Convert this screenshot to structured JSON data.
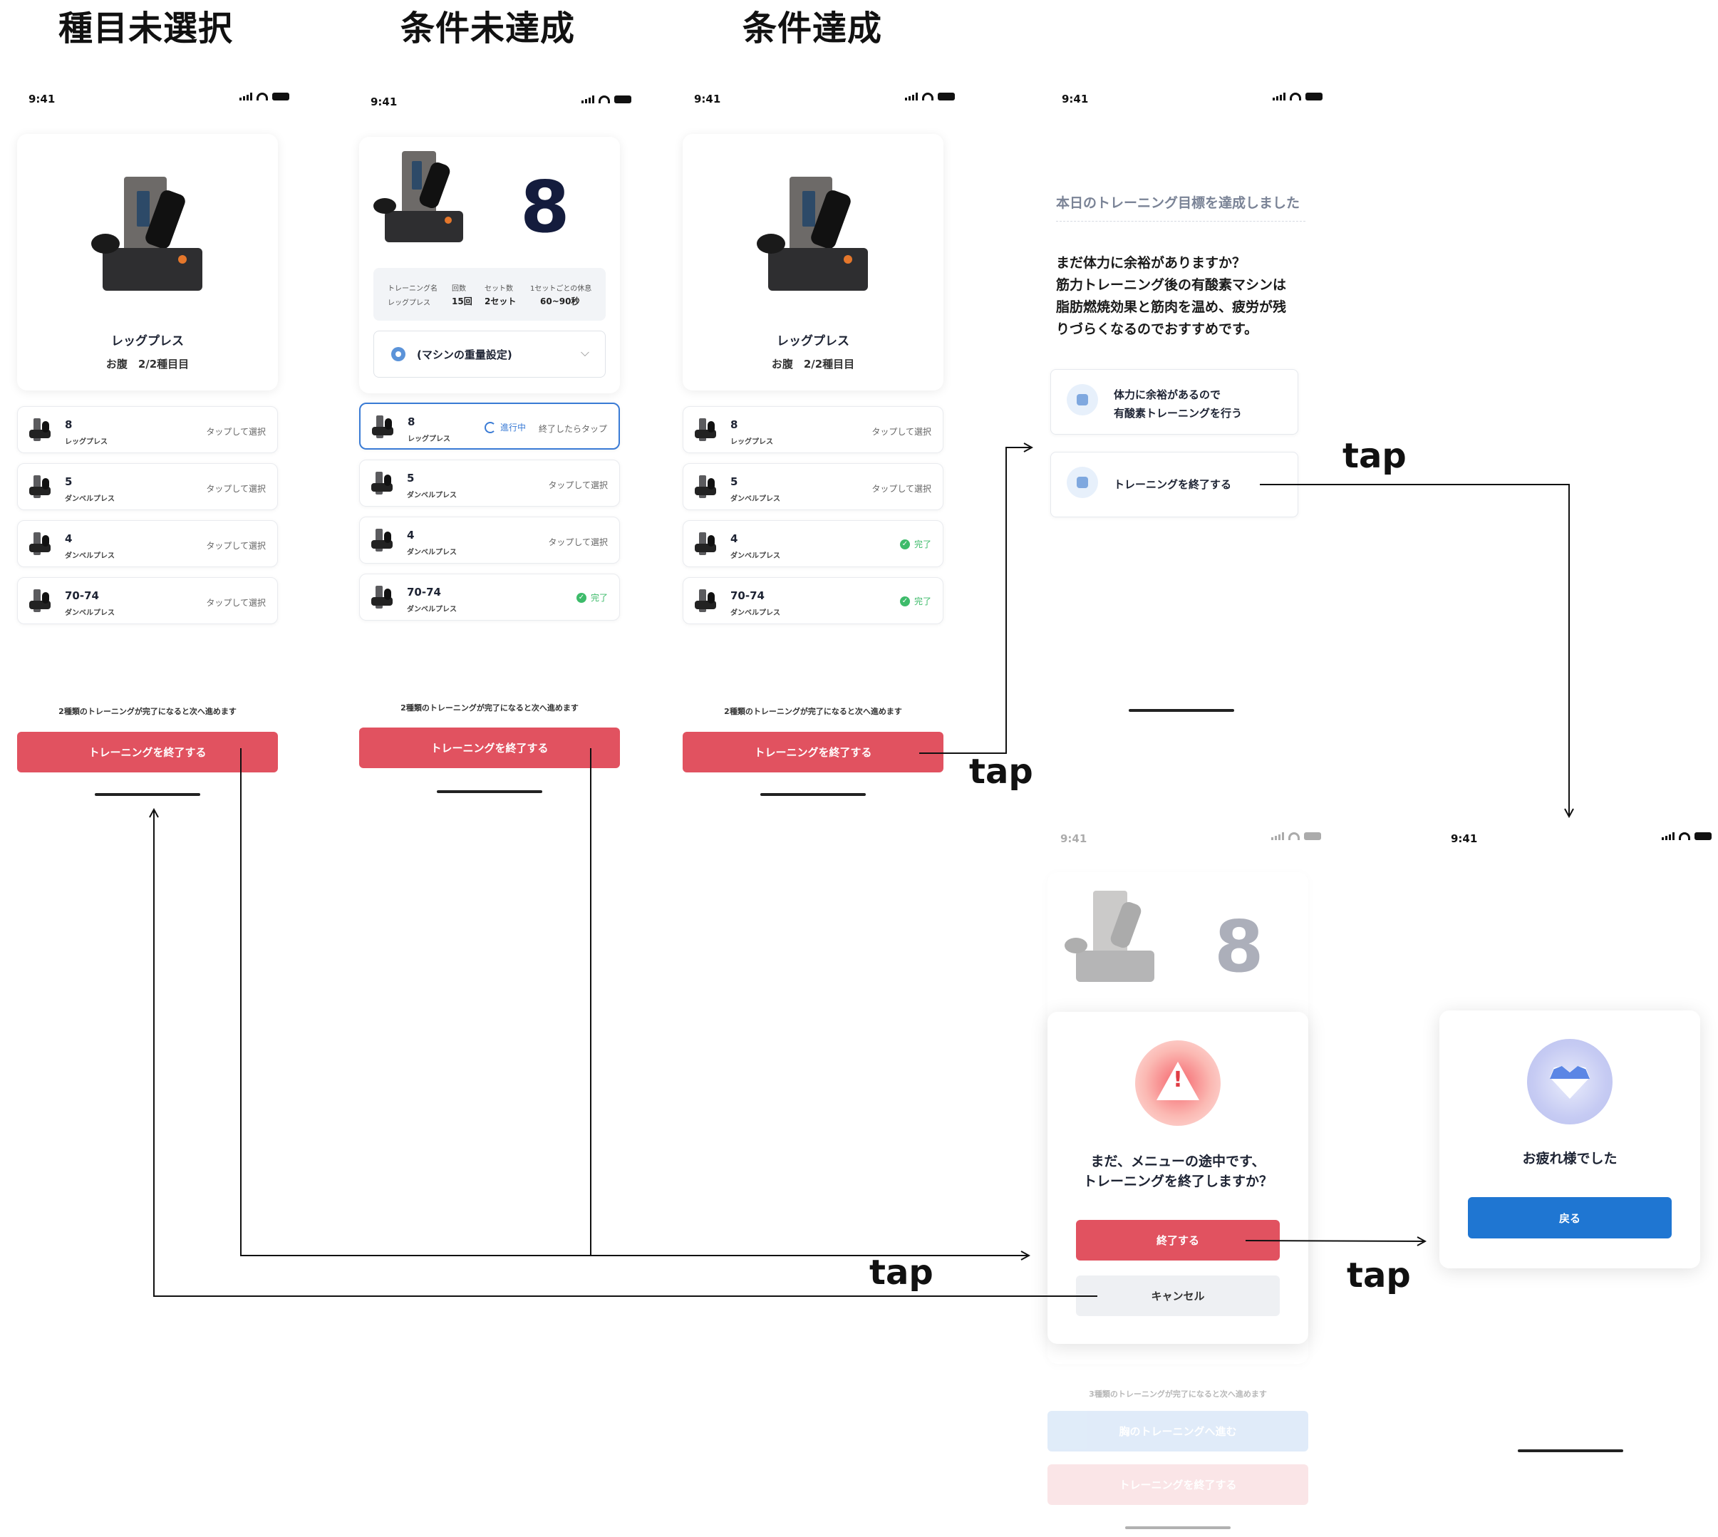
{
  "headings": {
    "s1": "種目未選択",
    "s2": "条件未達成",
    "s3": "条件達成"
  },
  "status_time": "9:41",
  "exercise": {
    "name": "レッグプレス",
    "sub": "お腹　2/2種目目",
    "big_number": "8"
  },
  "info": {
    "labels": [
      "トレーニング名",
      "回数",
      "セット数",
      "1セットごとの休息"
    ],
    "values": [
      "レッグプレス",
      "15回",
      "2セット",
      "60~90秒"
    ]
  },
  "weight_select": "(マシンの重量設定)",
  "rows": [
    {
      "num": "8",
      "sub": "レッグプレス"
    },
    {
      "num": "5",
      "sub": "ダンベルプレス"
    },
    {
      "num": "4",
      "sub": "ダンベルプレス"
    },
    {
      "num": "70-74",
      "sub": "ダンベルプレス"
    }
  ],
  "row_labels": {
    "tap_select": "タップして選択",
    "in_progress": "進行中",
    "tap_when_done": "終了したらタップ",
    "done": "完了"
  },
  "note": "2種類のトレーニングが完了になると次へ進めます",
  "note3": "3種類のトレーニングが完了になると次へ進めます",
  "finish_button": "トレーニングを終了する",
  "goal": {
    "title": "本日のトレーニング目標を達成しました",
    "body1": "まだ体力に余裕がありますか？",
    "body2": "筋力トレーニング後の有酸素マシンは",
    "body3": "脂肪燃焼効果と筋肉を温め、疲労が残",
    "body4": "りづらくなるのでおすすめです。",
    "opt1a": "体力に余裕があるので",
    "opt1b": "有酸素トレーニングを行う",
    "opt2": "トレーニングを終了する"
  },
  "modal": {
    "line1": "まだ、メニューの途中です、",
    "line2": "トレーニングを終了しますか？",
    "ok": "終了する",
    "cancel": "キャンセル",
    "next_chest": "胸のトレーニングへ進む"
  },
  "thanks": {
    "text": "お疲れ様でした",
    "back": "戻る"
  },
  "tap": "tap",
  "colors": {
    "red": "#e15260",
    "blue": "#1f76d2",
    "green": "#3dbb6a",
    "navy": "#141c3d"
  }
}
